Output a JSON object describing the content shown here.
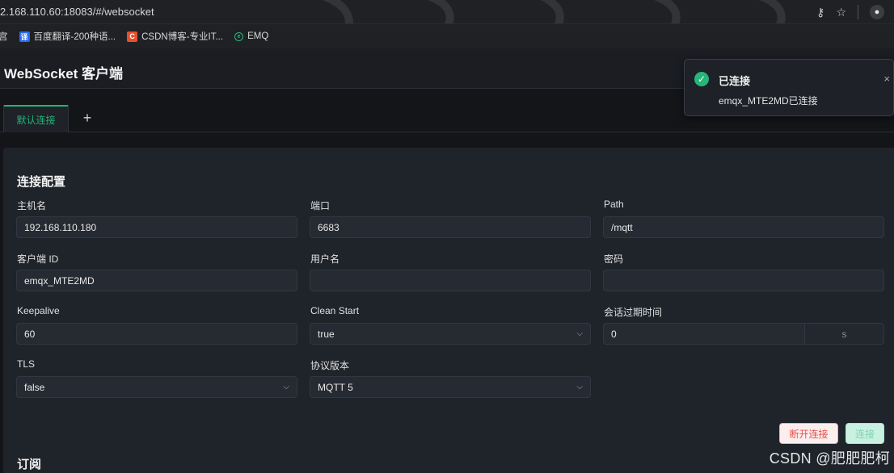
{
  "browser": {
    "url": "2.168.110.60:18083/#/websocket",
    "bookmarks": [
      {
        "icon": "bookmark-icon",
        "label": "宫"
      },
      {
        "icon": "fanyi-icon",
        "icon_text": "译",
        "label": "百度翻译-200种语..."
      },
      {
        "icon": "csdn-icon",
        "icon_text": "C",
        "label": "CSDN博客-专业IT..."
      },
      {
        "icon": "emq-icon",
        "icon_text": "e",
        "label": "EMQ"
      }
    ]
  },
  "app": {
    "title": "WebSocket 客户端",
    "tabs": [
      {
        "label": "默认连接"
      }
    ],
    "add_tab": "+"
  },
  "connection": {
    "section_title": "连接配置",
    "fields": {
      "host": {
        "label": "主机名",
        "value": "192.168.110.180"
      },
      "port": {
        "label": "端口",
        "value": "6683"
      },
      "path": {
        "label": "Path",
        "value": "/mqtt"
      },
      "client_id": {
        "label": "客户端 ID",
        "value": "emqx_MTE2MD"
      },
      "username": {
        "label": "用户名",
        "value": ""
      },
      "password": {
        "label": "密码",
        "value": ""
      },
      "keepalive": {
        "label": "Keepalive",
        "value": "60"
      },
      "clean_start": {
        "label": "Clean Start",
        "value": "true"
      },
      "session_expiry": {
        "label": "会话过期时间",
        "value": "0",
        "unit": "s"
      },
      "tls": {
        "label": "TLS",
        "value": "false"
      },
      "protocol_version": {
        "label": "协议版本",
        "value": "MQTT 5"
      }
    },
    "buttons": {
      "disconnect": "断开连接",
      "connect": "连接"
    }
  },
  "subscription": {
    "section_title": "订阅"
  },
  "notification": {
    "title": "已连接",
    "message": "emqx_MTE2MD已连接",
    "close": "×",
    "color": "#28b57a"
  },
  "watermark": "CSDN @肥肥肥柯",
  "colors": {
    "accent": "#22b47a",
    "danger": "#e2504a",
    "background": "#131519"
  }
}
